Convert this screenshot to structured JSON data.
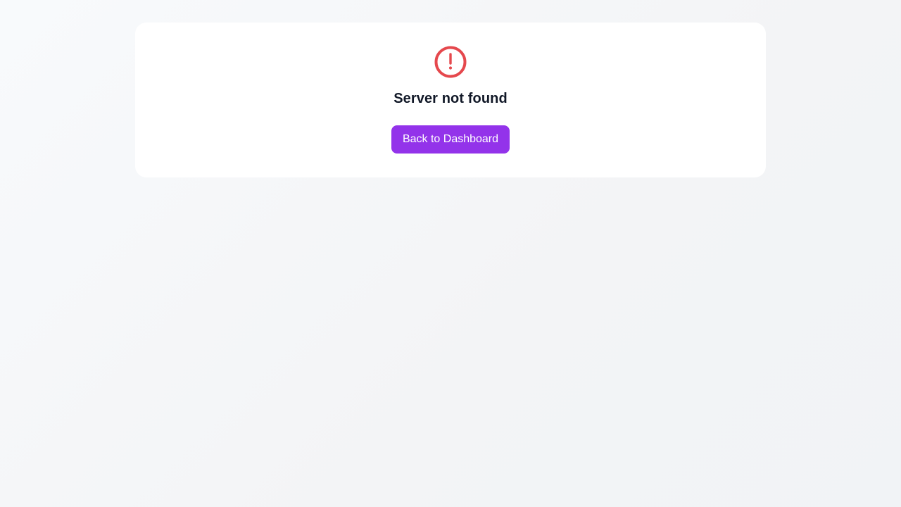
{
  "error": {
    "icon": "alert-circle-icon",
    "icon_color": "#e5484d",
    "title": "Server not found"
  },
  "actions": {
    "back_label": "Back to Dashboard",
    "button_color": "#9333ea"
  }
}
